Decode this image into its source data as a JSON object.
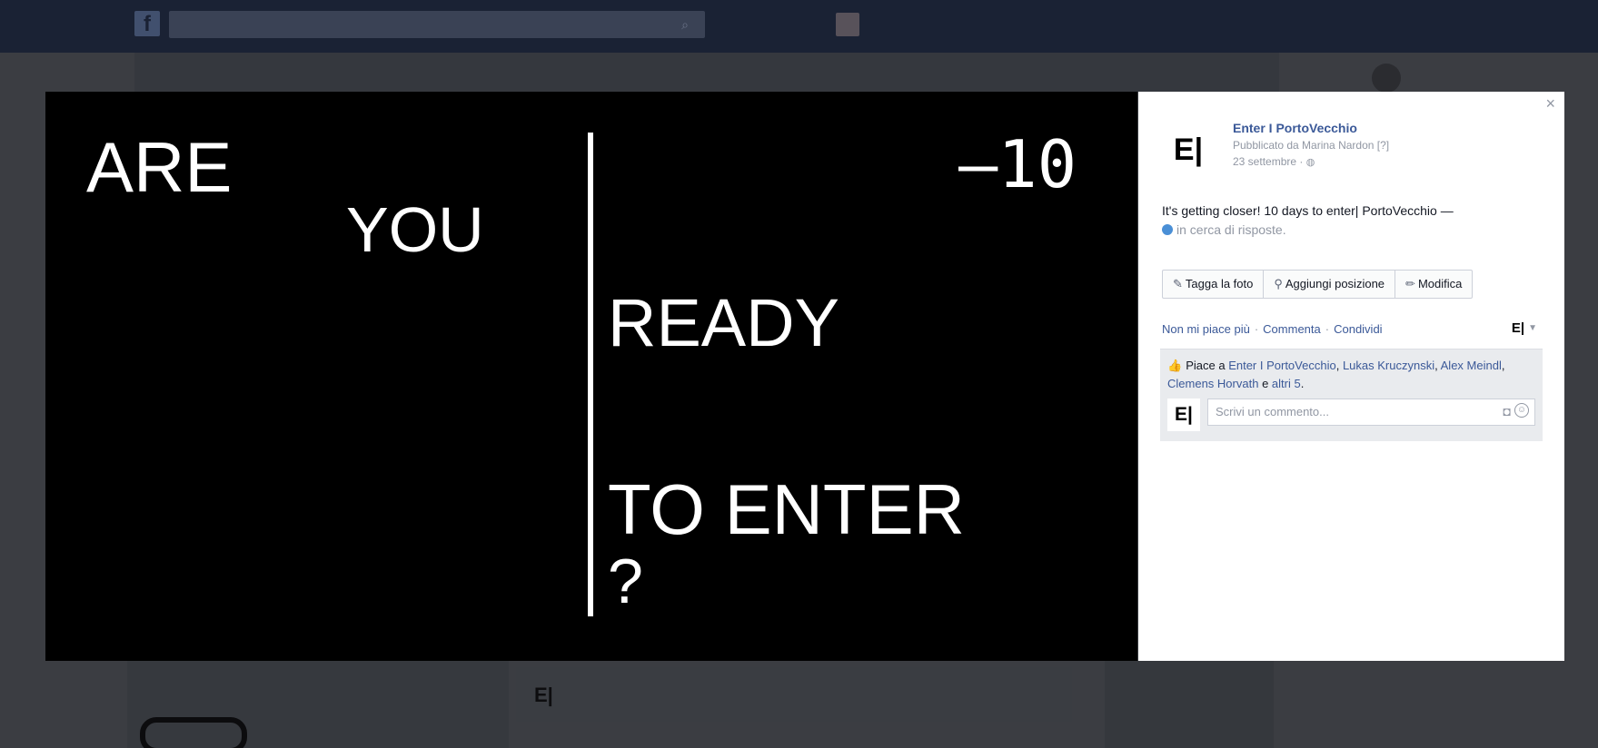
{
  "photo": {
    "line1": "ARE",
    "line2": "YOU",
    "countdown": "–10",
    "line3": "READY",
    "line4": "TO ENTER",
    "line5": "?"
  },
  "panel": {
    "close_glyph": "×",
    "page_logo": "E|",
    "page_name": "Enter I PortoVecchio",
    "posted_by": "Pubblicato da Marina Nardon [?]",
    "posted_date": "23 settembre ·",
    "globe_glyph": "◍",
    "caption": "It's getting closer! 10 days to enter| PortoVecchio —",
    "activity": "in cerca di risposte.",
    "actions": {
      "tag_icon": "✎",
      "tag_label": "Tagga la foto",
      "location_icon": "⚲",
      "location_label": "Aggiungi posizione",
      "edit_icon": "✏",
      "edit_label": "Modifica"
    },
    "links": {
      "unlike": "Non mi piace più",
      "comment": "Commenta",
      "share": "Condividi",
      "sep": "·"
    },
    "voice_label": "E|",
    "voice_caret": "▼",
    "likes": {
      "thumb_icon": "👍",
      "prefix": "Piace a",
      "names_1": "Enter I PortoVecchio",
      "comma": ",",
      "names_2": "Lukas Kruczynski",
      "names_3": "Alex Meindl",
      "names_4": "Clemens Horvath",
      "and": "e",
      "others": "altri 5",
      "period": "."
    },
    "comment": {
      "logo": "E|",
      "placeholder": "Scrivi un commento...",
      "camera_icon": "◘",
      "emoji_icon": "☺"
    }
  }
}
